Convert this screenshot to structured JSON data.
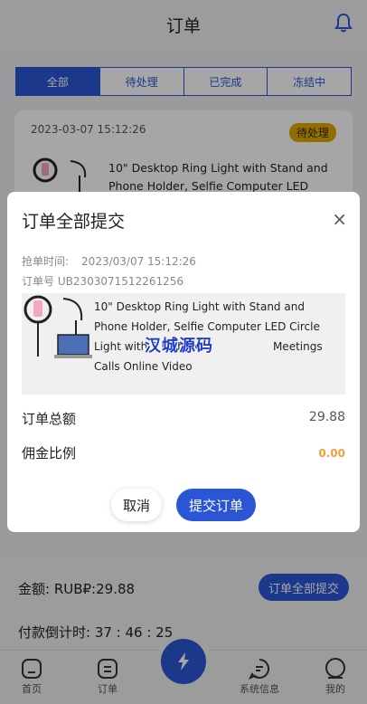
{
  "header": {
    "title": "订单"
  },
  "tabs": [
    "全部",
    "待处理",
    "已完成",
    "冻结中"
  ],
  "order_card": {
    "date": "2023-03-07 15:12:26",
    "status": "待处理",
    "title": "10\" Desktop Ring Light with Stand and Phone Holder, Selfie Computer LED Circle"
  },
  "modal": {
    "title": "订单全部提交",
    "close": "×",
    "grab_time_label": "抢单时间:",
    "grab_time_value": "2023/03/07 15:12:26",
    "order_no": "订单号 UB2303071512261256",
    "product_title": "10\" Desktop Ring Light with Stand and Phone Holder, Selfie Computer LED Circle Light with 3 Light Mo",
    "product_title_rest": "Meetings Calls Online Video",
    "watermark": "汉城源码",
    "total_label": "订单总额",
    "total_value": "29.88",
    "commission_label": "佣金比例",
    "commission_value": "0.00",
    "cancel_label": "取消",
    "submit_label": "提交订单"
  },
  "bottom": {
    "amount_label": "金额: RUB₽:29.88",
    "submit_all_label": "订单全部提交",
    "countdown_label": "付款倒计时: 37 : 46 : 25"
  },
  "tabbar": {
    "home": "首页",
    "orders": "订单",
    "system": "系统信息",
    "mine": "我的"
  },
  "colors": {
    "primary": "#2a56d6",
    "badge": "#e0a800",
    "commission": "#f0a03c"
  },
  "icons": [
    "bell-icon",
    "home-icon",
    "orders-icon",
    "lightning-icon",
    "chat-icon",
    "user-icon",
    "close-icon"
  ]
}
